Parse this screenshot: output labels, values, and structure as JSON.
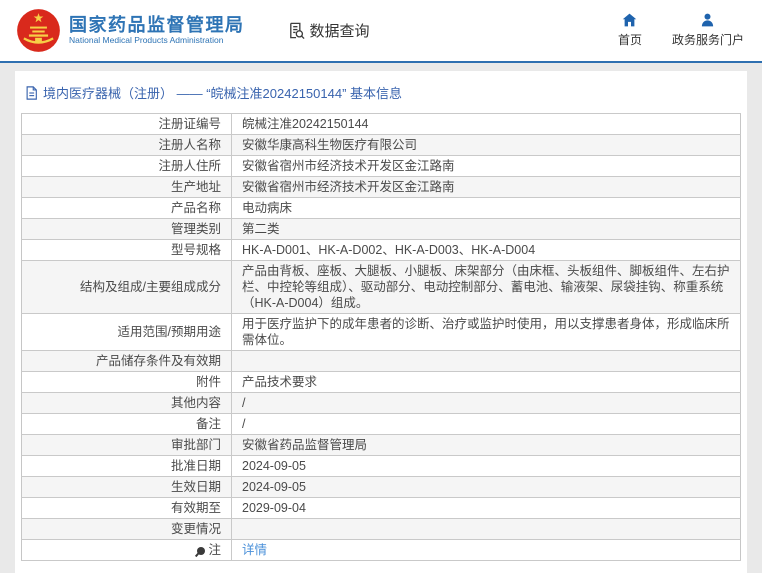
{
  "header": {
    "title": "国家药品监督管理局",
    "subtitle": "National Medical Products Administration",
    "nav_query_label": "数据查询",
    "home_label": "首页",
    "portal_label": "政务服务门户"
  },
  "breadcrumb": {
    "text": "境内医疗器械（注册） —— “皖械注准20242150144” 基本信息"
  },
  "table": {
    "rows": [
      {
        "label": "注册证编号",
        "value": "皖械注准20242150144"
      },
      {
        "label": "注册人名称",
        "value": "安徽华康高科生物医疗有限公司"
      },
      {
        "label": "注册人住所",
        "value": "安徽省宿州市经济技术开发区金江路南"
      },
      {
        "label": "生产地址",
        "value": "安徽省宿州市经济技术开发区金江路南"
      },
      {
        "label": "产品名称",
        "value": "电动病床"
      },
      {
        "label": "管理类别",
        "value": "第二类"
      },
      {
        "label": "型号规格",
        "value": "HK-A-D001、HK-A-D002、HK-A-D003、HK-A-D004"
      },
      {
        "label": "结构及组成/主要组成成分",
        "value": "产品由背板、座板、大腿板、小腿板、床架部分（由床框、头板组件、脚板组件、左右护栏、中控轮等组成）、驱动部分、电动控制部分、蓄电池、输液架、尿袋挂钩、称重系统（HK-A-D004）组成。"
      },
      {
        "label": "适用范围/预期用途",
        "value": "用于医疗监护下的成年患者的诊断、治疗或监护时使用，用以支撑患者身体，形成临床所需体位。"
      },
      {
        "label": "产品储存条件及有效期",
        "value": ""
      },
      {
        "label": "附件",
        "value": "产品技术要求"
      },
      {
        "label": "其他内容",
        "value": "/"
      },
      {
        "label": "备注",
        "value": "/"
      },
      {
        "label": "审批部门",
        "value": "安徽省药品监督管理局"
      },
      {
        "label": "批准日期",
        "value": "2024-09-05"
      },
      {
        "label": "生效日期",
        "value": "2024-09-05"
      },
      {
        "label": "有效期至",
        "value": "2029-09-04"
      },
      {
        "label": "变更情况",
        "value": ""
      },
      {
        "label": "注",
        "value": "详情",
        "link": true,
        "note_icon": true
      }
    ]
  },
  "icons": {
    "emblem": "china-national-emblem",
    "doc_search": "document-search-icon",
    "home": "house-icon",
    "portal": "person-icon",
    "breadcrumb_doc": "document-icon",
    "note": "balloon-note-icon"
  },
  "colors": {
    "accent_blue": "#2e74b5",
    "header_border": "#2e6fb0",
    "breadcrumb_blue": "#3a64ae",
    "link_blue": "#4a90d9",
    "row_alt": "#f5f5f5",
    "table_border": "#c9c9c9",
    "page_bg": "#e9e9e9",
    "emblem_red": "#d9291c",
    "emblem_yellow": "#f7cf46"
  }
}
